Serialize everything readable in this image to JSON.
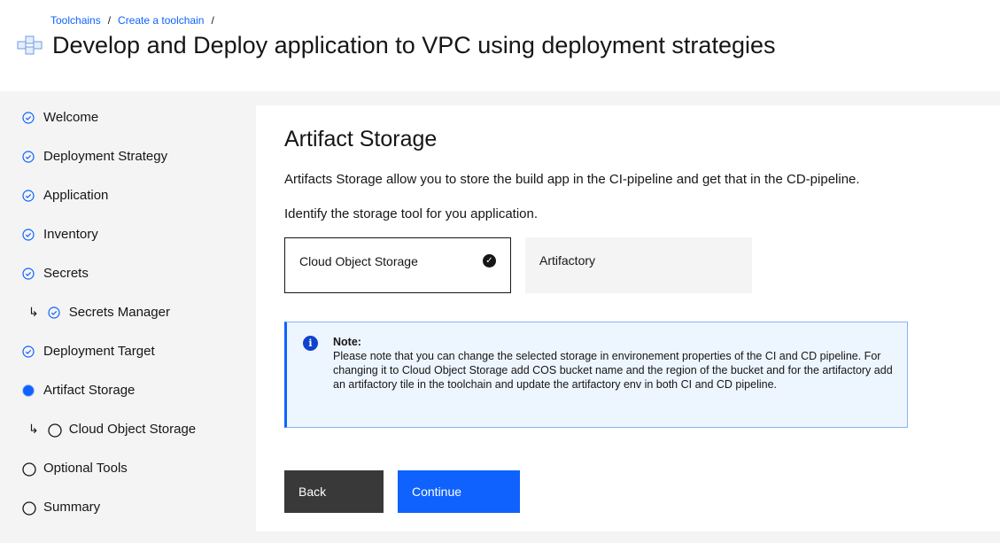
{
  "breadcrumb": [
    "Toolchains",
    "Create a toolchain"
  ],
  "page_title": "Develop and Deploy application to VPC using deployment strategies",
  "sidebar": {
    "items": [
      {
        "label": "Welcome",
        "state": "complete",
        "sub": false
      },
      {
        "label": "Deployment Strategy",
        "state": "complete",
        "sub": false
      },
      {
        "label": "Application",
        "state": "complete",
        "sub": false
      },
      {
        "label": "Inventory",
        "state": "complete",
        "sub": false
      },
      {
        "label": "Secrets",
        "state": "complete",
        "sub": false
      },
      {
        "label": "Secrets Manager",
        "state": "complete",
        "sub": true
      },
      {
        "label": "Deployment Target",
        "state": "complete",
        "sub": false
      },
      {
        "label": "Artifact Storage",
        "state": "current",
        "sub": false
      },
      {
        "label": "Cloud Object Storage",
        "state": "incomplete",
        "sub": true
      },
      {
        "label": "Optional Tools",
        "state": "incomplete",
        "sub": false
      },
      {
        "label": "Summary",
        "state": "incomplete",
        "sub": false
      }
    ]
  },
  "main": {
    "heading": "Artifact Storage",
    "description": "Artifacts Storage allow you to store the build app in the CI-pipeline and get that in the CD-pipeline.",
    "prompt": "Identify the storage tool for you application.",
    "tiles": [
      {
        "label": "Cloud Object Storage",
        "selected": true
      },
      {
        "label": "Artifactory",
        "selected": false
      }
    ],
    "note": {
      "title": "Note:",
      "body": "Please note that you can change the selected storage in environement properties of the CI and CD pipeline. For changing it to Cloud Object Storage add COS bucket name and the region of the bucket and for the artifactory add an artifactory tile in the toolchain and update the artifactory env in both CI and CD pipeline."
    },
    "back_label": "Back",
    "continue_label": "Continue"
  },
  "colors": {
    "accent": "#0f62fe",
    "dark": "#393939"
  }
}
